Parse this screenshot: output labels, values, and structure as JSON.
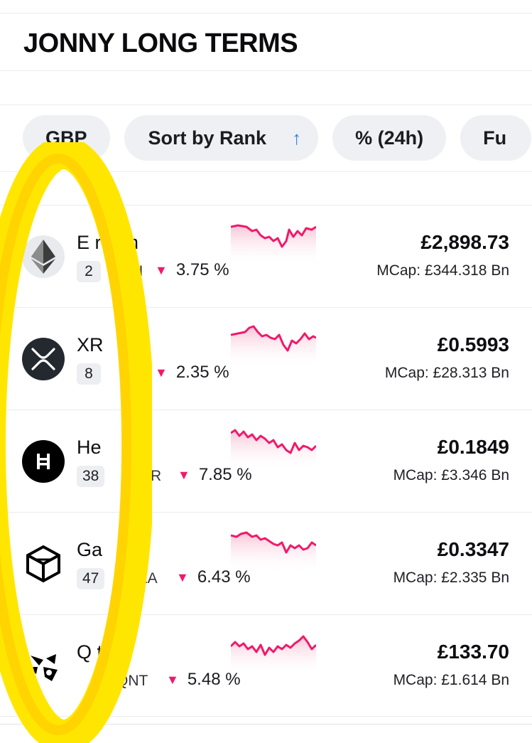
{
  "page": {
    "title": "JONNY LONG TERMS"
  },
  "filters": {
    "currency": "GBP",
    "sort_label": "Sort by Rank",
    "sort_arrow": "↑",
    "change_period": "% (24h)",
    "more_partial": "Fu"
  },
  "colors": {
    "accent_blue": "#2b7de9",
    "down_pink": "#f0196a",
    "highlight_yellow": "#ffe600"
  },
  "coins": [
    {
      "name": "Ethereum",
      "visible_name": "E      reum",
      "rank": "2",
      "symbol": "H",
      "change": "3.75 %",
      "price": "£2,898.73",
      "mcap": "MCap: £344.318 Bn",
      "icon": "ethereum-icon"
    },
    {
      "name": "XRP",
      "visible_name": "XR",
      "rank": "8",
      "symbol": "",
      "change": "2.35 %",
      "price": "£0.5993",
      "mcap": "MCap: £28.313 Bn",
      "icon": "xrp-icon"
    },
    {
      "name": "Hedera",
      "visible_name": "He",
      "rank": "38",
      "symbol": "R",
      "change": "7.85 %",
      "price": "£0.1849",
      "mcap": "MCap: £3.346 Bn",
      "icon": "hedera-icon"
    },
    {
      "name": "Gala",
      "visible_name": "Ga",
      "rank": "47",
      "symbol": "LA",
      "change": "6.43 %",
      "price": "£0.3347",
      "mcap": "MCap: £2.335 Bn",
      "icon": "gala-icon"
    },
    {
      "name": "Quant",
      "visible_name": "Q      t",
      "rank": "",
      "symbol": "QNT",
      "change": "5.48 %",
      "price": "£133.70",
      "mcap": "MCap: £1.614 Bn",
      "icon": "quant-icon"
    }
  ]
}
